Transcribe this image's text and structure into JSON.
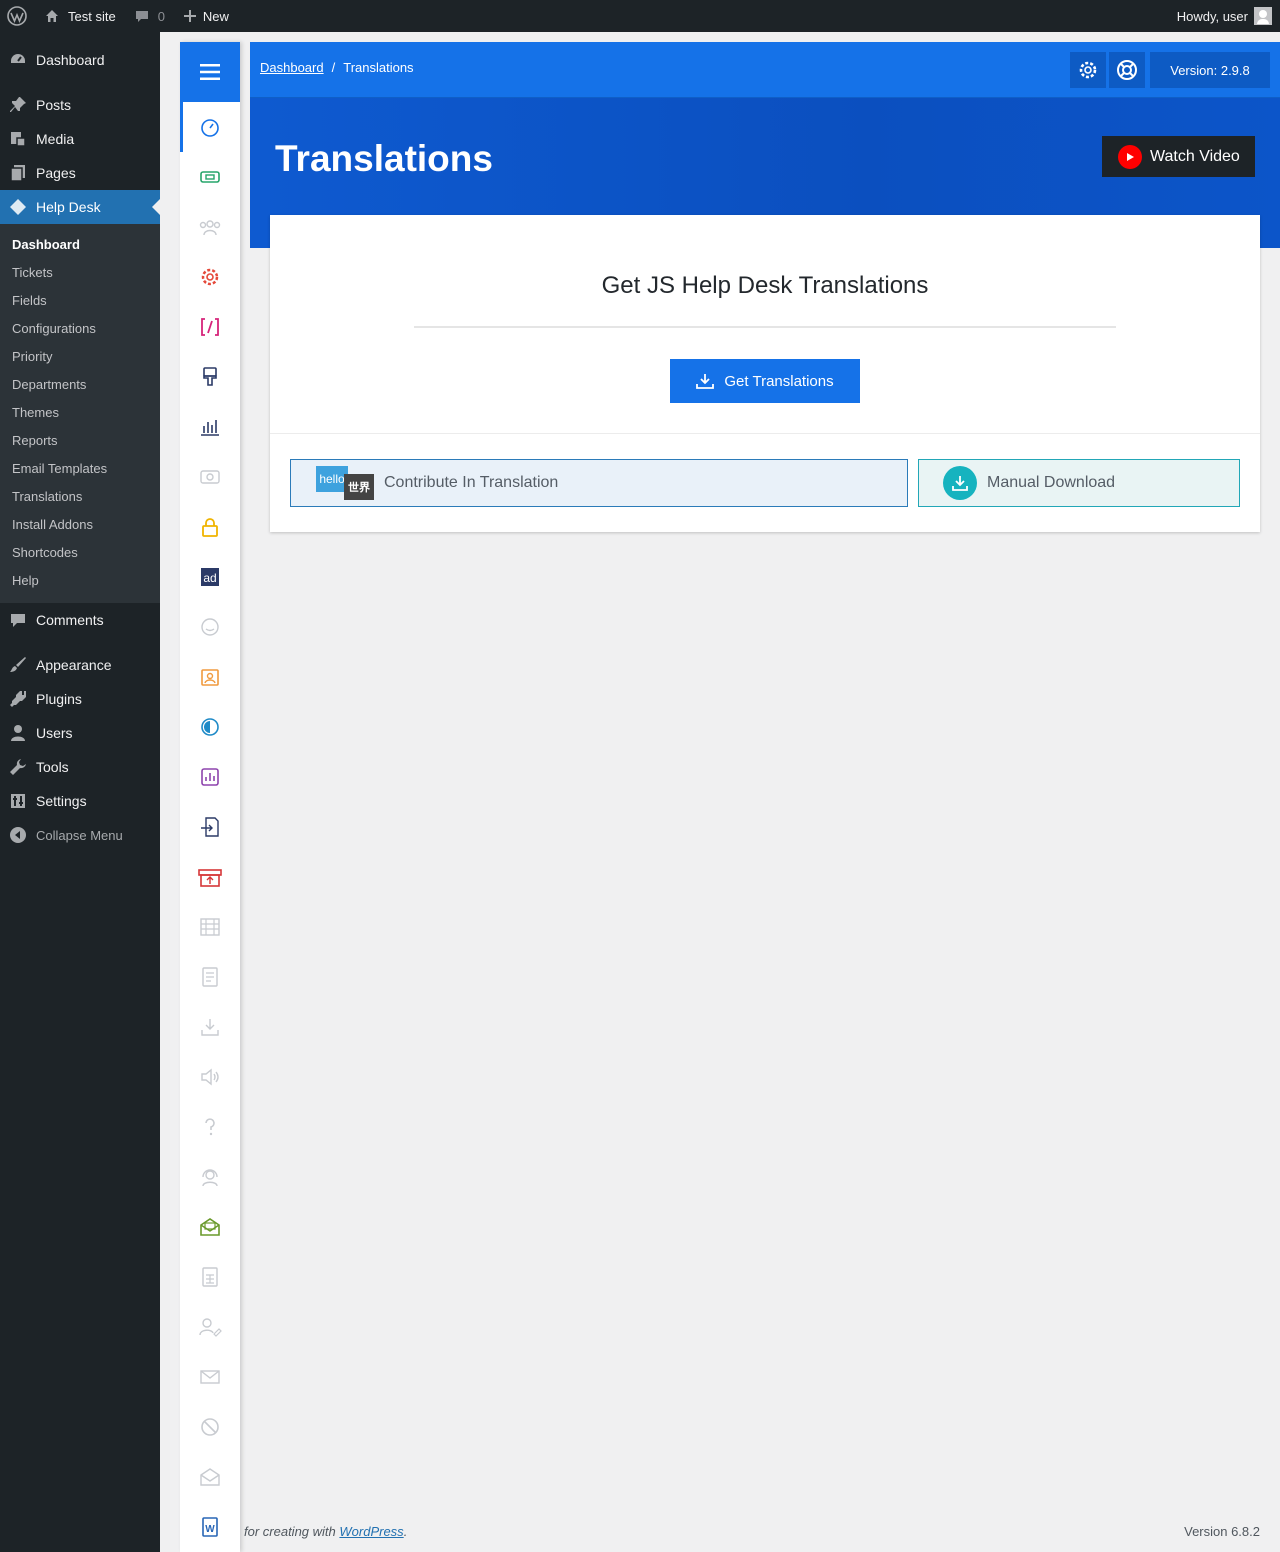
{
  "adminbar": {
    "site_name": "Test site",
    "comments_count": "0",
    "new_label": "New",
    "howdy": "Howdy, user"
  },
  "wp_menu": {
    "items_top": [
      {
        "label": "Dashboard",
        "icon": "dashboard-icon"
      },
      {
        "label": "Posts",
        "icon": "pin-icon"
      },
      {
        "label": "Media",
        "icon": "media-icon"
      },
      {
        "label": "Pages",
        "icon": "pages-icon"
      },
      {
        "label": "Help Desk",
        "icon": "ticket-icon"
      }
    ],
    "submenu": [
      "Dashboard",
      "Tickets",
      "Fields",
      "Configurations",
      "Priority",
      "Departments",
      "Themes",
      "Reports",
      "Email Templates",
      "Translations",
      "Install Addons",
      "Shortcodes",
      "Help"
    ],
    "items_bottom": [
      {
        "label": "Comments",
        "icon": "comment-icon"
      },
      {
        "label": "Appearance",
        "icon": "brush-icon"
      },
      {
        "label": "Plugins",
        "icon": "plugin-icon"
      },
      {
        "label": "Users",
        "icon": "user-icon"
      },
      {
        "label": "Tools",
        "icon": "wrench-icon"
      },
      {
        "label": "Settings",
        "icon": "settings-icon"
      }
    ],
    "collapse": "Collapse Menu"
  },
  "topbar": {
    "breadcrumb_home": "Dashboard",
    "breadcrumb_separator": "/",
    "breadcrumb_current": "Translations",
    "version": "Version: 2.9.8"
  },
  "header": {
    "title": "Translations",
    "watch_video": "Watch Video"
  },
  "card": {
    "heading": "Get JS Help Desk Translations",
    "get_button": "Get Translations",
    "contribute": "Contribute In Translation",
    "contribute_logo_en": "hello",
    "contribute_logo_cn": "世界",
    "manual_download": "Manual Download"
  },
  "footer": {
    "thanks_text": "for creating with",
    "wp_link": "WordPress",
    "period": ".",
    "version": "Version 6.8.2"
  },
  "colors": {
    "primary": "#1572e8",
    "admin_dark": "#1d2327",
    "wp_blue": "#2271b1"
  }
}
